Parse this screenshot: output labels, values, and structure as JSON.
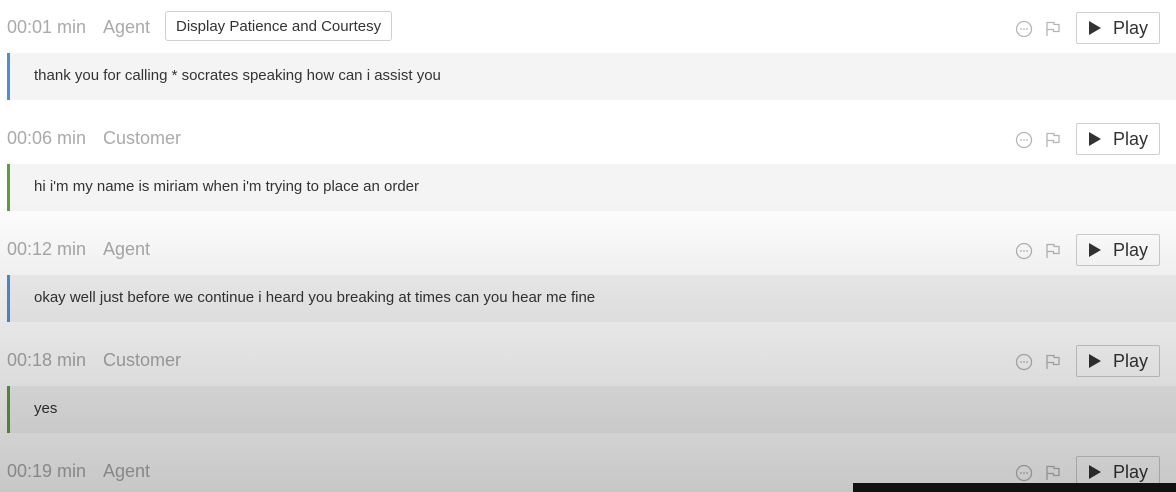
{
  "transcript": {
    "entries": [
      {
        "time": "00:01 min",
        "speaker": "Agent",
        "tag": "Display Patience and Courtesy",
        "text": "thank you for calling * socrates speaking how can i assist you",
        "play_label": "Play"
      },
      {
        "time": "00:06 min",
        "speaker": "Customer",
        "text": "hi i'm my name is miriam when i'm trying to place an order",
        "play_label": "Play"
      },
      {
        "time": "00:12 min",
        "speaker": "Agent",
        "text": "okay well just before we continue i heard you breaking at times can you hear me fine",
        "play_label": "Play"
      },
      {
        "time": "00:18 min",
        "speaker": "Customer",
        "text": "yes",
        "play_label": "Play"
      },
      {
        "time": "00:19 min",
        "speaker": "Agent",
        "play_label": "Play"
      }
    ]
  },
  "colors": {
    "agent_accent": "#4a90d9",
    "customer_accent": "#5e9e3a",
    "muted_text": "#aaaaaa"
  },
  "icons": [
    "comment-icon",
    "flag-icon",
    "play-icon"
  ]
}
